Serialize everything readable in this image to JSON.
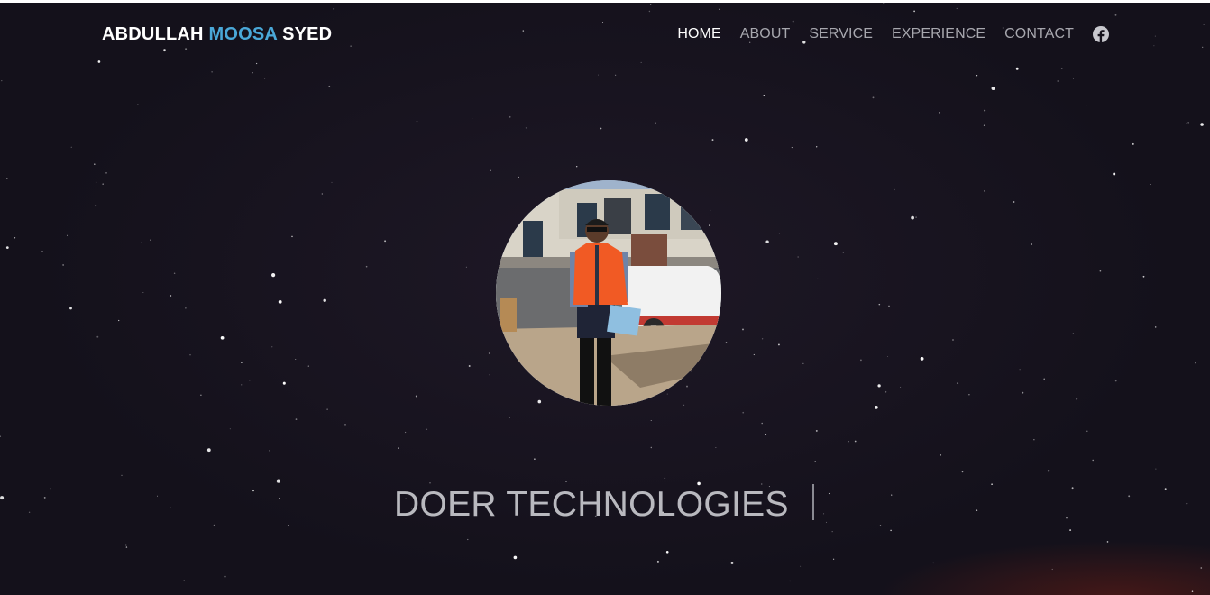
{
  "header": {
    "brand_first": "ABDULLAH",
    "brand_middle": "MOOSA",
    "brand_last": "SYED",
    "brand_accent_color": "#4aa8d8"
  },
  "nav": {
    "items": [
      {
        "label": "HOME",
        "active": true
      },
      {
        "label": "ABOUT",
        "active": false
      },
      {
        "label": "SERVICE",
        "active": false
      },
      {
        "label": "EXPERIENCE",
        "active": false
      },
      {
        "label": "CONTACT",
        "active": false
      }
    ],
    "social_icon": "facebook-icon"
  },
  "hero": {
    "headline": "DOER TECHNOLOGIES",
    "background_color": "#14111b"
  }
}
